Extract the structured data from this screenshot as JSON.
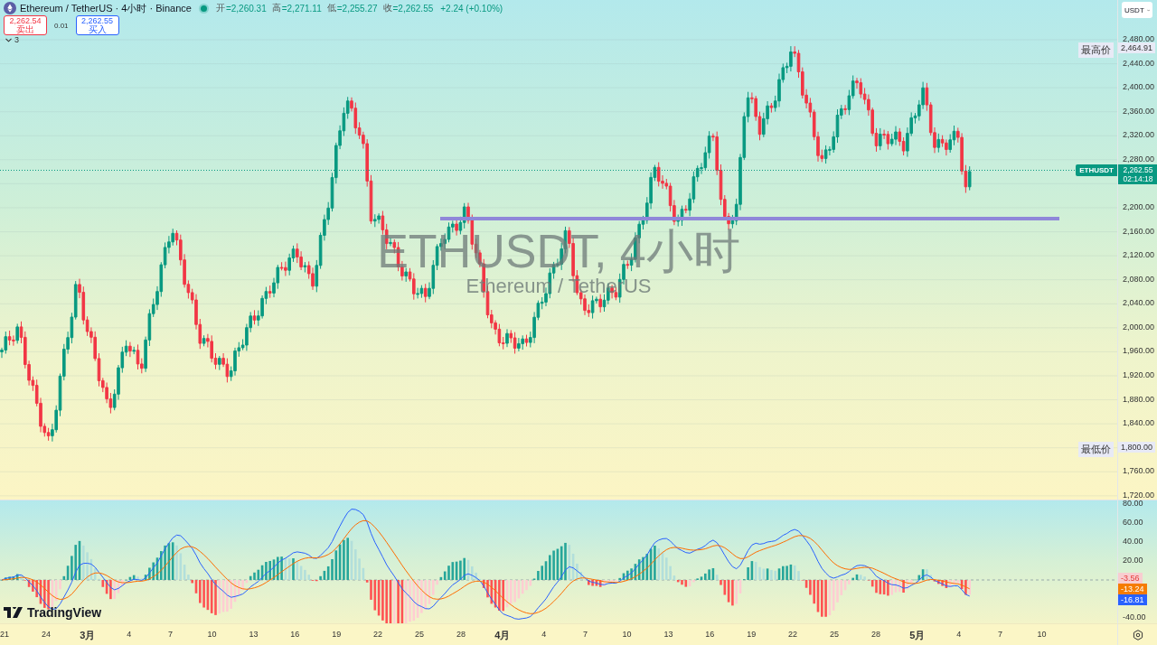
{
  "header": {
    "title": "Ethereum / TetherUS · 4小时 · Binance",
    "ohlc": [
      {
        "label": "开",
        "value": "=2,260.31"
      },
      {
        "label": "高",
        "value": "=2,271.11"
      },
      {
        "label": "低",
        "value": "=2,255.27"
      },
      {
        "label": "收",
        "value": "=2,262.55"
      }
    ],
    "change": "+2.24 (+0.10%)"
  },
  "trade": {
    "sell": {
      "price": "2,262.54",
      "label": "卖出"
    },
    "spread": "0.01",
    "buy": {
      "price": "2,262.55",
      "label": "买入"
    }
  },
  "indicators_toggle": {
    "count": "3"
  },
  "watermark": {
    "symbol": "ETHUSDT, 4小时",
    "name": "Ethereum / TetherUS"
  },
  "currency": "USDT",
  "price_axis": {
    "upper_ticks": [
      "2,480.00",
      "2,440.00",
      "2,400.00",
      "2,360.00",
      "2,320.00",
      "2,280.00"
    ],
    "lower_ticks": [
      "2,200.00",
      "2,160.00",
      "2,120.00",
      "2,080.00",
      "2,040.00",
      "2,000.00",
      "1,960.00",
      "1,920.00",
      "1,880.00",
      "1,840.00"
    ],
    "bottom_ticks": [
      "1,760.00",
      "1,720.00"
    ],
    "high": {
      "label": "最高价",
      "value": "2,464.91"
    },
    "low": {
      "label": "最低价",
      "value": "1,800.00"
    },
    "last": {
      "symbol": "ETHUSDT",
      "price": "2,262.55",
      "countdown": "02:14:18"
    }
  },
  "oscillator_axis": {
    "ticks": [
      "80.00",
      "60.00",
      "40.00",
      "20.00"
    ],
    "lower_tick": "-40.00",
    "badges": [
      {
        "value": "-3.56",
        "kind": "histogram",
        "color": "#f8cdd0"
      },
      {
        "value": "-13.24",
        "kind": "signal",
        "color": "#f57c00"
      },
      {
        "value": "-16.81",
        "kind": "macd",
        "color": "#2962ff"
      }
    ]
  },
  "time_axis": [
    {
      "label": "21",
      "kind": "day"
    },
    {
      "label": "24",
      "kind": "day"
    },
    {
      "label": "3月",
      "kind": "month"
    },
    {
      "label": "4",
      "kind": "day"
    },
    {
      "label": "7",
      "kind": "day"
    },
    {
      "label": "10",
      "kind": "day"
    },
    {
      "label": "13",
      "kind": "day"
    },
    {
      "label": "16",
      "kind": "day"
    },
    {
      "label": "19",
      "kind": "day"
    },
    {
      "label": "22",
      "kind": "day"
    },
    {
      "label": "25",
      "kind": "day"
    },
    {
      "label": "28",
      "kind": "day"
    },
    {
      "label": "4月",
      "kind": "month"
    },
    {
      "label": "4",
      "kind": "day"
    },
    {
      "label": "7",
      "kind": "day"
    },
    {
      "label": "10",
      "kind": "day"
    },
    {
      "label": "13",
      "kind": "day"
    },
    {
      "label": "16",
      "kind": "day"
    },
    {
      "label": "19",
      "kind": "day"
    },
    {
      "label": "22",
      "kind": "day"
    },
    {
      "label": "25",
      "kind": "day"
    },
    {
      "label": "28",
      "kind": "day"
    },
    {
      "label": "5月",
      "kind": "month"
    },
    {
      "label": "4",
      "kind": "day"
    },
    {
      "label": "7",
      "kind": "day"
    },
    {
      "label": "10",
      "kind": "day"
    }
  ],
  "brand": "TradingView"
}
